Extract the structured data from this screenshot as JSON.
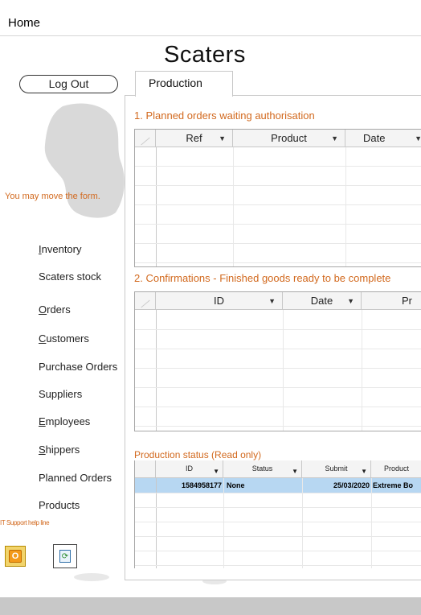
{
  "top": {
    "tab_label": "Home"
  },
  "app": {
    "title": "Scaters"
  },
  "sidebar": {
    "logout_label": "Log Out",
    "hint": "You may move the form.",
    "items": [
      {
        "label": "Inventory",
        "accel": "I"
      },
      {
        "label": "Scaters stock",
        "accel": ""
      },
      {
        "label": "Orders",
        "accel": "O"
      },
      {
        "label": "Customers",
        "accel": "C"
      },
      {
        "label": "Purchase Orders",
        "accel": ""
      },
      {
        "label": "Suppliers",
        "accel": ""
      },
      {
        "label": "Employees",
        "accel": "E"
      },
      {
        "label": "Shippers",
        "accel": "S"
      },
      {
        "label": "Planned Orders",
        "accel": ""
      },
      {
        "label": "Products",
        "accel": ""
      }
    ],
    "it_help": "IT Support help line"
  },
  "tabs": {
    "production": "Production"
  },
  "sections": {
    "planned": {
      "title": "1. Planned orders waiting authorisation",
      "columns": [
        "Ref",
        "Product",
        "Date"
      ]
    },
    "confirmations": {
      "title": "2. Confirmations - Finished goods ready to be complete",
      "columns": [
        "ID",
        "Date",
        "Pr"
      ]
    },
    "status": {
      "title": "Production status (Read only)",
      "columns": [
        "ID",
        "Status",
        "Submit",
        "Product"
      ],
      "rows": [
        {
          "id": "1584958177",
          "status": "None",
          "submit": "25/03/2020",
          "product": "Extreme Bo"
        }
      ]
    }
  },
  "colors": {
    "accent": "#d2691e",
    "selected_row": "#b7d7f2",
    "footer": "#c8c8c8"
  }
}
